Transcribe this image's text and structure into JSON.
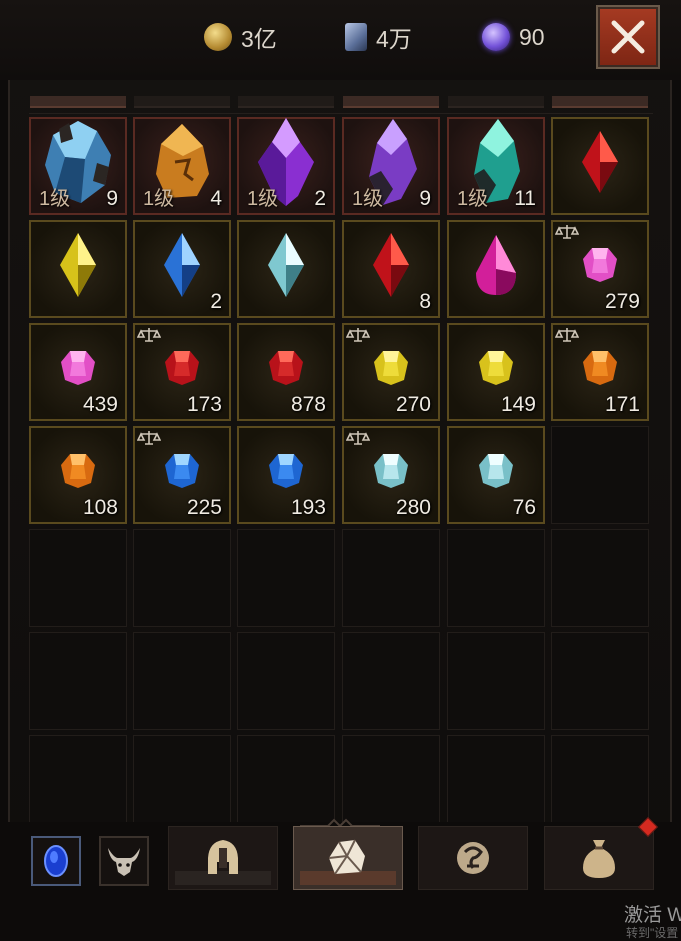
{
  "currencies": [
    {
      "name": "gold",
      "icon": "gold-coin-icon",
      "value": "3亿"
    },
    {
      "name": "scroll",
      "icon": "scroll-icon",
      "value": "4万"
    },
    {
      "name": "orb",
      "icon": "purple-orb-icon",
      "value": "90"
    }
  ],
  "close_icon": "close-x-icon",
  "colors": {
    "close_button": "#8f2e19",
    "count_text": "#f0ebe2",
    "level_text": "#cdb9a0"
  },
  "inventory": {
    "row1": [
      {
        "name": "blue-crystal",
        "level": "1级",
        "count": "9"
      },
      {
        "name": "amber-rune",
        "level": "1级",
        "count": "4"
      },
      {
        "name": "purple-crystal",
        "level": "1级",
        "count": "2"
      },
      {
        "name": "violet-crystal",
        "level": "1级",
        "count": "9"
      },
      {
        "name": "teal-crystal",
        "level": "1级",
        "count": "11"
      },
      {
        "name": "red-marquise-gem",
        "level": "",
        "count": ""
      }
    ],
    "row2": [
      {
        "name": "yellow-marquise-gem",
        "count": ""
      },
      {
        "name": "blue-marquise-gem",
        "count": "2"
      },
      {
        "name": "white-marquise-gem",
        "count": ""
      },
      {
        "name": "red-marquise-gem",
        "count": "8"
      },
      {
        "name": "pink-teardrop-gem",
        "count": ""
      },
      {
        "name": "pink-round-gem",
        "count": "279",
        "tradeable": true
      }
    ],
    "row3": [
      {
        "name": "pink-round-gem",
        "count": "439"
      },
      {
        "name": "red-round-gem",
        "count": "173",
        "tradeable": true
      },
      {
        "name": "red-round-gem",
        "count": "878"
      },
      {
        "name": "yellow-round-gem",
        "count": "270",
        "tradeable": true
      },
      {
        "name": "yellow-round-gem",
        "count": "149"
      },
      {
        "name": "orange-round-gem",
        "count": "171",
        "tradeable": true
      }
    ],
    "row4": [
      {
        "name": "orange-round-gem",
        "count": "108"
      },
      {
        "name": "blue-round-gem",
        "count": "225",
        "tradeable": true
      },
      {
        "name": "blue-round-gem",
        "count": "193"
      },
      {
        "name": "white-round-gem",
        "count": "280",
        "tradeable": true
      },
      {
        "name": "white-round-gem",
        "count": "76"
      }
    ]
  },
  "bottom_tabs": [
    {
      "name": "blue-gem-slot",
      "icon": "blue-oval-gem-icon"
    },
    {
      "name": "beast-slot",
      "icon": "horned-beast-icon"
    },
    {
      "name": "helmet-tab",
      "icon": "helmet-icon"
    },
    {
      "name": "gem-tab",
      "icon": "crystal-tab-icon",
      "active": true
    },
    {
      "name": "rune-tab",
      "icon": "rune-icon"
    },
    {
      "name": "bag-tab",
      "icon": "money-bag-icon"
    }
  ],
  "watermark": {
    "line1": "激活 W",
    "line2": "转到\"设置"
  }
}
